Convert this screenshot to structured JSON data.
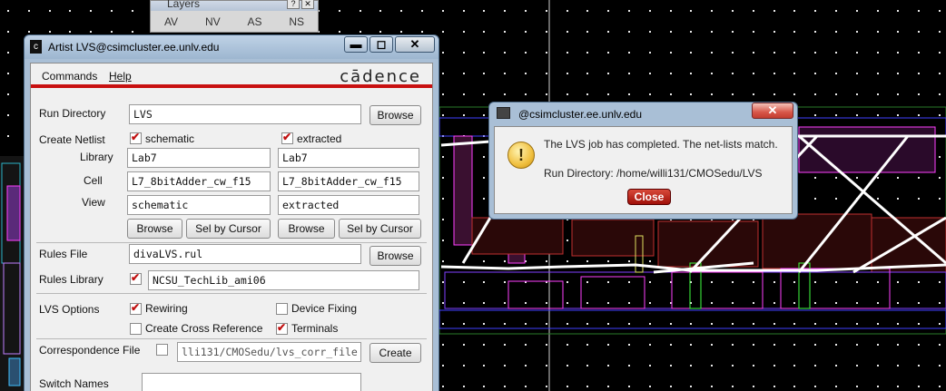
{
  "layers_palette": {
    "title": "Layers",
    "help_btn": "?",
    "close_btn": "✕",
    "tabs": [
      "AV",
      "NV",
      "AS",
      "NS"
    ]
  },
  "lvs_window": {
    "title": "Artist LVS@csimcluster.ee.unlv.edu",
    "app_icon": "c",
    "window_buttons": {
      "minimize": "▬",
      "maximize": "◻",
      "close": "✕"
    },
    "menu": {
      "commands": "Commands",
      "help": "Help",
      "brand": "cādence"
    },
    "run_directory": {
      "label": "Run Directory",
      "value": "LVS",
      "browse": "Browse"
    },
    "create_netlist": {
      "label": "Create Netlist",
      "schematic": {
        "label": "schematic",
        "checked": true
      },
      "extracted": {
        "label": "extracted",
        "checked": true
      }
    },
    "library": {
      "label": "Library",
      "schematic": "Lab7",
      "extracted": "Lab7"
    },
    "cell": {
      "label": "Cell",
      "schematic": "L7_8bitAdder_cw_f15",
      "extracted": "L7_8bitAdder_cw_f15"
    },
    "view": {
      "label": "View",
      "schematic": "schematic",
      "extracted": "extracted"
    },
    "browse_buttons": {
      "browse": "Browse",
      "sel_by_cursor": "Sel by Cursor"
    },
    "rules_file": {
      "label": "Rules File",
      "value": "divaLVS.rul",
      "browse": "Browse"
    },
    "rules_library": {
      "label": "Rules Library",
      "checked": true,
      "value": "NCSU_TechLib_ami06"
    },
    "lvs_options": {
      "label": "LVS Options",
      "rewiring": {
        "label": "Rewiring",
        "checked": true
      },
      "device_fixing": {
        "label": "Device Fixing",
        "checked": false
      },
      "create_cross_reference": {
        "label": "Create Cross Reference",
        "checked": false
      },
      "terminals": {
        "label": "Terminals",
        "checked": true
      }
    },
    "correspondence_file": {
      "label": "Correspondence File",
      "checked": false,
      "value": "lli131/CMOSedu/lvs_corr_file",
      "create": "Create"
    },
    "switch_names": {
      "label": "Switch Names",
      "value": ""
    }
  },
  "dialog": {
    "title": "@csimcluster.ee.unlv.edu",
    "close_x": "✕",
    "message_line1": "The LVS job has completed. The net-lists match.",
    "message_line2": "Run Directory: /home/willi131/CMOSedu/LVS",
    "close_button": "Close"
  },
  "colors": {
    "background": "#000000",
    "accent_red": "#c81010",
    "window_frame": "#a9bfd6"
  }
}
